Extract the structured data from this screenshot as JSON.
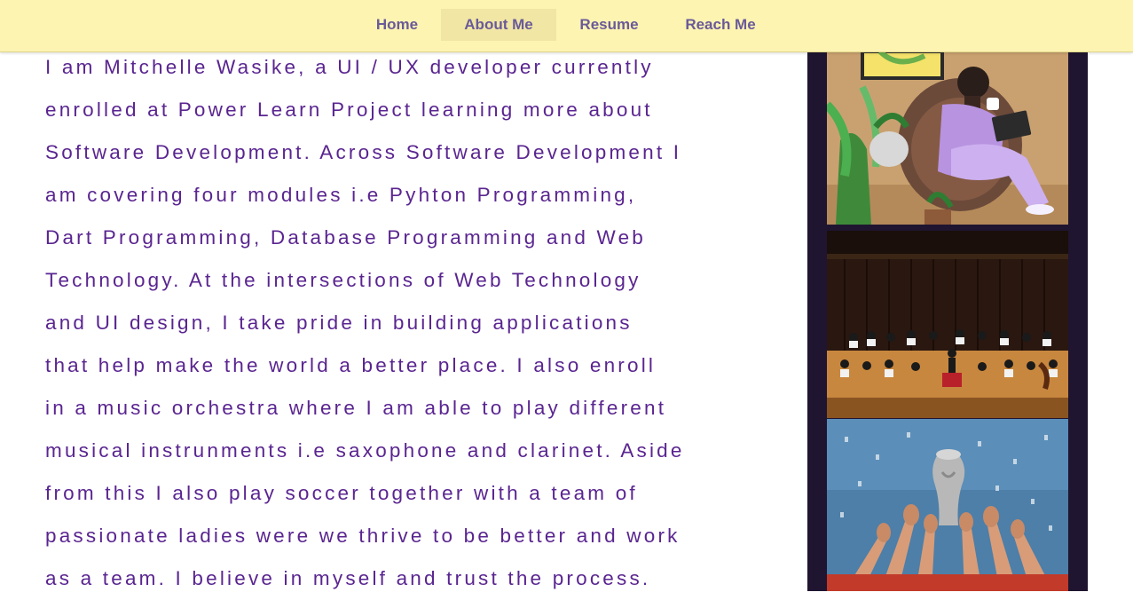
{
  "nav": {
    "items": [
      {
        "label": "Home"
      },
      {
        "label": "About Me"
      },
      {
        "label": "Resume"
      },
      {
        "label": "Reach Me"
      }
    ],
    "active": "About Me"
  },
  "about": {
    "lines": [
      "I am Mitchelle Wasike, a UI / UX developer currently",
      "enrolled at Power Learn Project learning more about",
      "Software Development. Across Software Development I",
      "am covering four modules i.e Pyhton Programming,",
      "Dart Programming, Database Programming and Web",
      "Technology. At the intersections of Web Technology",
      "and UI design, I take pride in building applications",
      "that help make the world a better place. I also enroll",
      "in a music orchestra where I am able to play different",
      "musical instrunments i.e saxophone and clarinet. Aside",
      "from this I also play soccer together with a team of",
      "passionate ladies were we thrive to be better and work",
      "as a team. I believe in myself and trust the process."
    ]
  },
  "gallery": {
    "photos": [
      {
        "subject": "illustration-woman-with-plants"
      },
      {
        "subject": "orchestra-on-stage"
      },
      {
        "subject": "soccer-trophy-celebration"
      }
    ]
  },
  "colors": {
    "nav_bg": "#fdf4b2",
    "nav_active_bg": "#f1e6a4",
    "nav_text": "#6a5a99",
    "body_text": "#5a2590",
    "gallery_bg": "#1f1530"
  }
}
